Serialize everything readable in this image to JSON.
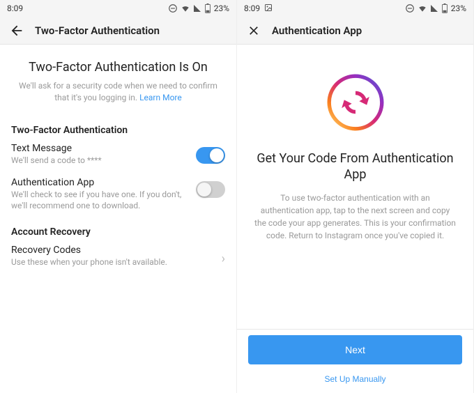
{
  "statusbar": {
    "time": "8:09",
    "battery": "23%"
  },
  "screen1": {
    "title": "Two-Factor Authentication",
    "hero_title": "Two-Factor Authentication Is On",
    "hero_sub_prefix": "We'll ask for a security code when we need to confirm that it's you logging in. ",
    "hero_link": "Learn More",
    "section_2fa": "Two-Factor Authentication",
    "text_message_label": "Text Message",
    "text_message_desc": "We'll send a code to ****",
    "auth_app_label": "Authentication App",
    "auth_app_desc": "We'll check to see if you have one. If you don't, we'll recommend one to download.",
    "section_recovery": "Account Recovery",
    "recovery_label": "Recovery Codes",
    "recovery_desc": "Use these when your phone isn't available."
  },
  "screen2": {
    "title": "Authentication App",
    "hero_title": "Get Your Code From Authentication App",
    "hero_desc": "To use two-factor authentication with an authentication app, tap to the next screen and copy the code your app generates. This is your confirmation code. Return to Instagram once you've copied it.",
    "btn_next": "Next",
    "btn_manual": "Set Up Manually"
  }
}
